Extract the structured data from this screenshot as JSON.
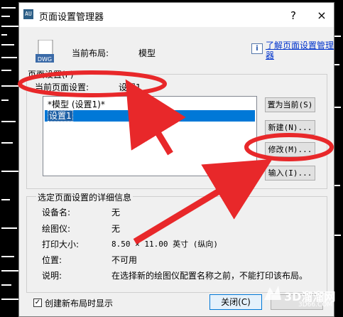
{
  "window": {
    "title": "页面设置管理器",
    "help_glyph": "?",
    "close_glyph": "×",
    "app_icon_text": "AU"
  },
  "layout": {
    "label": "当前布局:",
    "value": "模型",
    "file_icon_text": "DWG"
  },
  "help_link": {
    "info_glyph": "i",
    "text": "了解页面设置管理器"
  },
  "page_setups": {
    "group_label": "页面设置(P)",
    "current_label": "当前页面设置:",
    "current_value": "设置1",
    "items": [
      {
        "label": "*模型 (设置1)*",
        "selected": false
      },
      {
        "label": "设置1",
        "selected": true
      }
    ],
    "buttons": {
      "set_current": "置为当前(S)",
      "new": "新建(N)...",
      "modify": "修改(M)...",
      "import": "输入(I)..."
    }
  },
  "details": {
    "group_label": "选定页面设置的详细信息",
    "rows": [
      {
        "label": "设备名:",
        "value": "无"
      },
      {
        "label": "绘图仪:",
        "value": "无"
      },
      {
        "label": "打印大小:",
        "value": "8.50 × 11.00 英寸 (纵向)"
      },
      {
        "label": "位置:",
        "value": "不可用"
      },
      {
        "label": "说明:",
        "value": "在选择新的绘图仪配置名称之前，不能打印该布局。"
      }
    ]
  },
  "footer": {
    "checkbox_label": "创建新布局时显示",
    "checkbox_checked": true,
    "check_glyph": "✓",
    "close_button": "关闭(C)"
  },
  "watermark": {
    "text": "3D溜溜网",
    "sub": "3D66.COM"
  },
  "colors": {
    "selection": "#0078d7",
    "annotation_red": "#e8282a",
    "link": "#0033cc"
  }
}
